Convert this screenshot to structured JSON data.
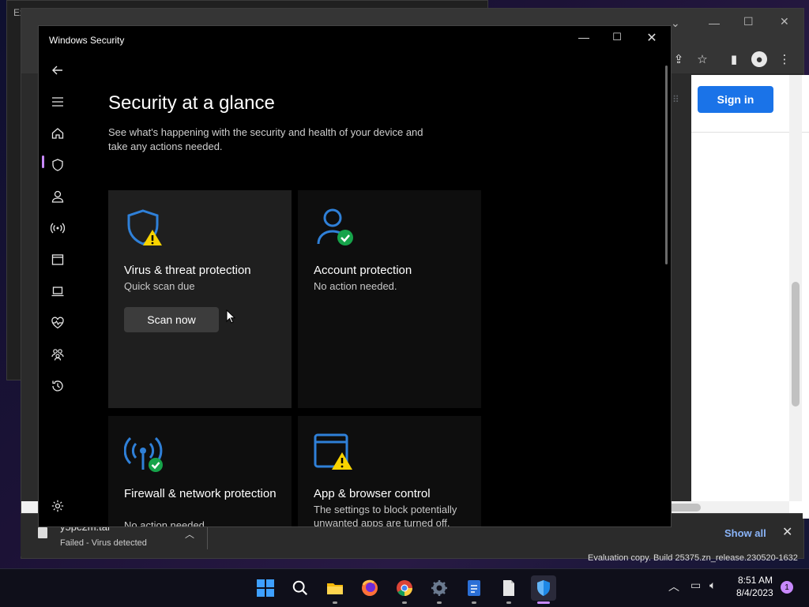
{
  "background": {
    "explorer_title": "Ex",
    "chrome": {
      "sign_in_label": "Sign in"
    },
    "download": {
      "file_name": "y5pc2m.tar",
      "status": "Failed - Virus detected",
      "show_all_label": "Show all"
    },
    "eval_text": "Evaluation copy. Build 25375.zn_release.230520-1632"
  },
  "window": {
    "title": "Windows Security"
  },
  "nav": {
    "items": [
      {
        "name": "back",
        "icon": "back-arrow-icon"
      },
      {
        "name": "menu",
        "icon": "hamburger-icon"
      },
      {
        "name": "home",
        "icon": "home-icon",
        "selected": true
      },
      {
        "name": "virus-threat",
        "icon": "shield-icon"
      },
      {
        "name": "account",
        "icon": "person-icon"
      },
      {
        "name": "firewall",
        "icon": "wifi-antenna-icon"
      },
      {
        "name": "app-browser",
        "icon": "browser-window-icon"
      },
      {
        "name": "device-security",
        "icon": "laptop-icon"
      },
      {
        "name": "device-performance",
        "icon": "heart-pulse-icon"
      },
      {
        "name": "family-options",
        "icon": "family-icon"
      },
      {
        "name": "protection-history",
        "icon": "history-icon"
      },
      {
        "name": "settings",
        "icon": "gear-icon"
      }
    ]
  },
  "main": {
    "heading": "Security at a glance",
    "subtitle": "See what's happening with the security and health of your device and take any actions needed.",
    "cards": [
      {
        "title": "Virus & threat protection",
        "description": "Quick scan due",
        "button": "Scan now",
        "status": "warning"
      },
      {
        "title": "Account protection",
        "description": "No action needed.",
        "status": "ok"
      },
      {
        "title": "Firewall & network protection",
        "description": "No action needed.",
        "status": "ok"
      },
      {
        "title": "App & browser control",
        "description": "The settings to block potentially unwanted apps are turned off.",
        "status": "warning"
      }
    ]
  },
  "colors": {
    "accent_blue": "#1a73e8",
    "icon_blue": "#2f80d8",
    "warning_yellow": "#f8d300",
    "ok_green": "#16a34a",
    "selection_purple": "#c889ff"
  },
  "taskbar": {
    "apps": [
      "start-icon",
      "search-icon",
      "file-explorer-icon",
      "firefox-icon",
      "chrome-icon",
      "settings-icon",
      "word-icon",
      "notepad-icon",
      "windows-security-icon"
    ],
    "time": "8:51 AM",
    "date": "8/4/2023",
    "notification_count": "1"
  }
}
